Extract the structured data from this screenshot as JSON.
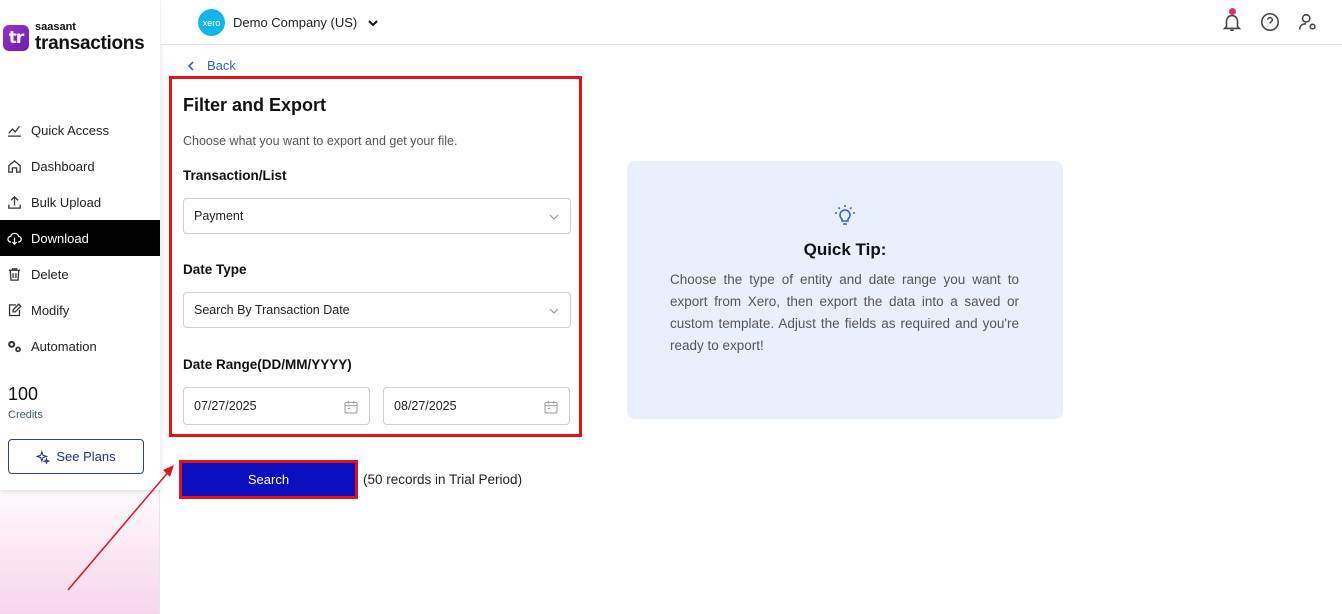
{
  "brand": {
    "badge": "tr",
    "small": "saasant",
    "big": "transactions"
  },
  "sidebar": {
    "items": [
      {
        "label": "Quick Access",
        "icon": "chart-line-icon",
        "active": false
      },
      {
        "label": "Dashboard",
        "icon": "home-icon",
        "active": false
      },
      {
        "label": "Bulk Upload",
        "icon": "upload-icon",
        "active": false
      },
      {
        "label": "Download",
        "icon": "cloud-download-icon",
        "active": true
      },
      {
        "label": "Delete",
        "icon": "trash-icon",
        "active": false
      },
      {
        "label": "Modify",
        "icon": "edit-icon",
        "active": false
      },
      {
        "label": "Automation",
        "icon": "gears-icon",
        "active": false
      }
    ],
    "credits_value": "100",
    "credits_label": "Credits",
    "see_plans_label": "See Plans"
  },
  "header": {
    "company_logo_text": "xero",
    "company_name": "Demo Company (US)"
  },
  "back_label": "Back",
  "filter": {
    "title": "Filter and Export",
    "subtitle": "Choose what you want to export and get your file.",
    "transaction_label": "Transaction/List",
    "transaction_value": "Payment",
    "date_type_label": "Date Type",
    "date_type_value": "Search By Transaction Date",
    "date_range_label": "Date Range(DD/MM/YYYY)",
    "date_from": "07/27/2025",
    "date_to": "08/27/2025"
  },
  "search": {
    "button_label": "Search",
    "records_note": "(50 records in Trial Period)"
  },
  "tip": {
    "title": "Quick Tip:",
    "body": "Choose the type of entity and date range you want to export from Xero, then export the data into a saved or custom template. Adjust the fields as required and you're ready to export!"
  },
  "colors": {
    "accent_blue": "#0c0fbf",
    "highlight_red": "#e3131b",
    "tip_background": "#eaf0fb",
    "active_nav": "#000000"
  }
}
